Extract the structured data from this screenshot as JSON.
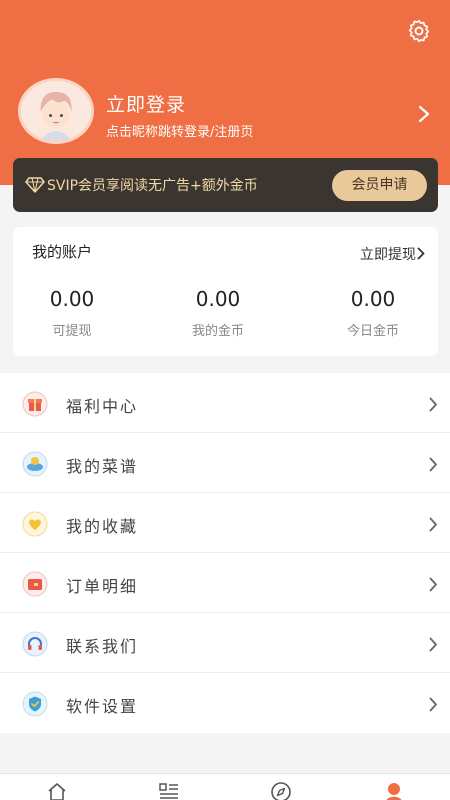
{
  "header": {
    "login_title": "立即登录",
    "login_subtitle": "点击昵称跳转登录/注册页",
    "accent_color": "#ef6e44"
  },
  "vip": {
    "text": "SVIP会员享阅读无广告+额外金币",
    "button_label": "会员申请",
    "icon": "diamond-icon"
  },
  "account": {
    "title": "我的账户",
    "withdraw_label": "立即提现",
    "stats": [
      {
        "value": "0.00",
        "label": "可提现"
      },
      {
        "value": "0.00",
        "label": "我的金币"
      },
      {
        "value": "0.00",
        "label": "今日金币"
      }
    ]
  },
  "menu": {
    "items": [
      {
        "label": "福利中心",
        "icon": "gift-icon"
      },
      {
        "label": "我的菜谱",
        "icon": "recipe-icon"
      },
      {
        "label": "我的收藏",
        "icon": "heart-icon"
      },
      {
        "label": "订单明细",
        "icon": "wallet-icon"
      },
      {
        "label": "联系我们",
        "icon": "headset-icon"
      },
      {
        "label": "软件设置",
        "icon": "shield-icon"
      }
    ]
  },
  "tabbar": {
    "tabs": [
      {
        "icon": "home-icon"
      },
      {
        "icon": "list-icon"
      },
      {
        "icon": "compass-icon"
      },
      {
        "icon": "user-icon"
      }
    ]
  }
}
